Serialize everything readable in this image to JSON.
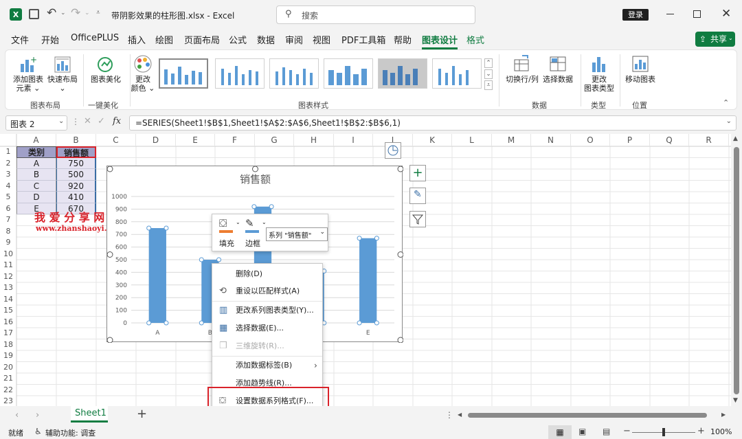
{
  "titlebar": {
    "filename": "带阴影效果的柱形图.xlsx",
    "app": "Excel",
    "search_placeholder": "搜索",
    "login_label": "登录"
  },
  "menu": {
    "items": [
      "文件",
      "开始",
      "OfficePLUS",
      "插入",
      "绘图",
      "页面布局",
      "公式",
      "数据",
      "审阅",
      "视图",
      "PDF工具箱",
      "帮助",
      "图表设计",
      "格式"
    ],
    "active": "图表设计",
    "share_label": "共享"
  },
  "ribbon": {
    "add_element": [
      "添加图表",
      "元素"
    ],
    "quick_layout": "快速布局",
    "group_layout": "图表布局",
    "chart_beautify": "图表美化",
    "group_beautify": "一键美化",
    "change_colors": [
      "更改",
      "颜色"
    ],
    "group_styles": "图表样式",
    "switch_row_col": "切换行/列",
    "select_data": "选择数据",
    "group_data": "数据",
    "change_type": [
      "更改",
      "图表类型"
    ],
    "group_type": "类型",
    "move_chart": "移动图表",
    "group_location": "位置"
  },
  "formula": {
    "namebox": "图表 2",
    "fx": "fx",
    "content": "=SERIES(Sheet1!$B$1,Sheet1!$A$2:$A$6,Sheet1!$B$2:$B$6,1)"
  },
  "columns": [
    "A",
    "B",
    "C",
    "D",
    "E",
    "F",
    "G",
    "H",
    "I",
    "J",
    "K",
    "L",
    "M",
    "N",
    "O",
    "P",
    "Q",
    "R"
  ],
  "rows": [
    "1",
    "2",
    "3",
    "4",
    "5",
    "6",
    "7",
    "8",
    "9",
    "10",
    "11",
    "12",
    "13",
    "14",
    "15",
    "16",
    "17",
    "18",
    "19",
    "20",
    "21",
    "22",
    "23"
  ],
  "table": {
    "headers": [
      "类别",
      "销售额"
    ],
    "rows": [
      [
        "A",
        "750"
      ],
      [
        "B",
        "500"
      ],
      [
        "C",
        "920"
      ],
      [
        "D",
        "410"
      ],
      [
        "E",
        "670"
      ]
    ]
  },
  "watermark": {
    "cn": "我 爱 分 享 网",
    "url": "www.zhanshaoyi.com"
  },
  "chart_data": {
    "type": "bar",
    "title": "销售额",
    "categories": [
      "A",
      "B",
      "C",
      "D",
      "E"
    ],
    "values": [
      750,
      500,
      920,
      410,
      670
    ],
    "ylim": [
      0,
      1000
    ],
    "yticks": [
      "0",
      "100",
      "200",
      "300",
      "400",
      "500",
      "600",
      "700",
      "800",
      "900",
      "1000"
    ],
    "grid": true,
    "bar_color": "#5b9bd5"
  },
  "minitoolbar": {
    "fill_label": "填充",
    "border_label": "边框",
    "series_select": "系列 \"销售额\""
  },
  "context_menu": {
    "items": [
      "删除(D)",
      "重设以匹配样式(A)",
      "更改系列图表类型(Y)...",
      "选择数据(E)...",
      "三维旋转(R)...",
      "添加数据标签(B)",
      "添加趋势线(R)...",
      "设置数据系列格式(F)..."
    ]
  },
  "sheet": {
    "tab": "Sheet1",
    "add": "+"
  },
  "status": {
    "ready": "就绪",
    "accessibility": "辅助功能: 调查",
    "zoom": "100%"
  },
  "colors": {
    "accent_green": "#107c41",
    "highlight_red": "#d9222a"
  }
}
